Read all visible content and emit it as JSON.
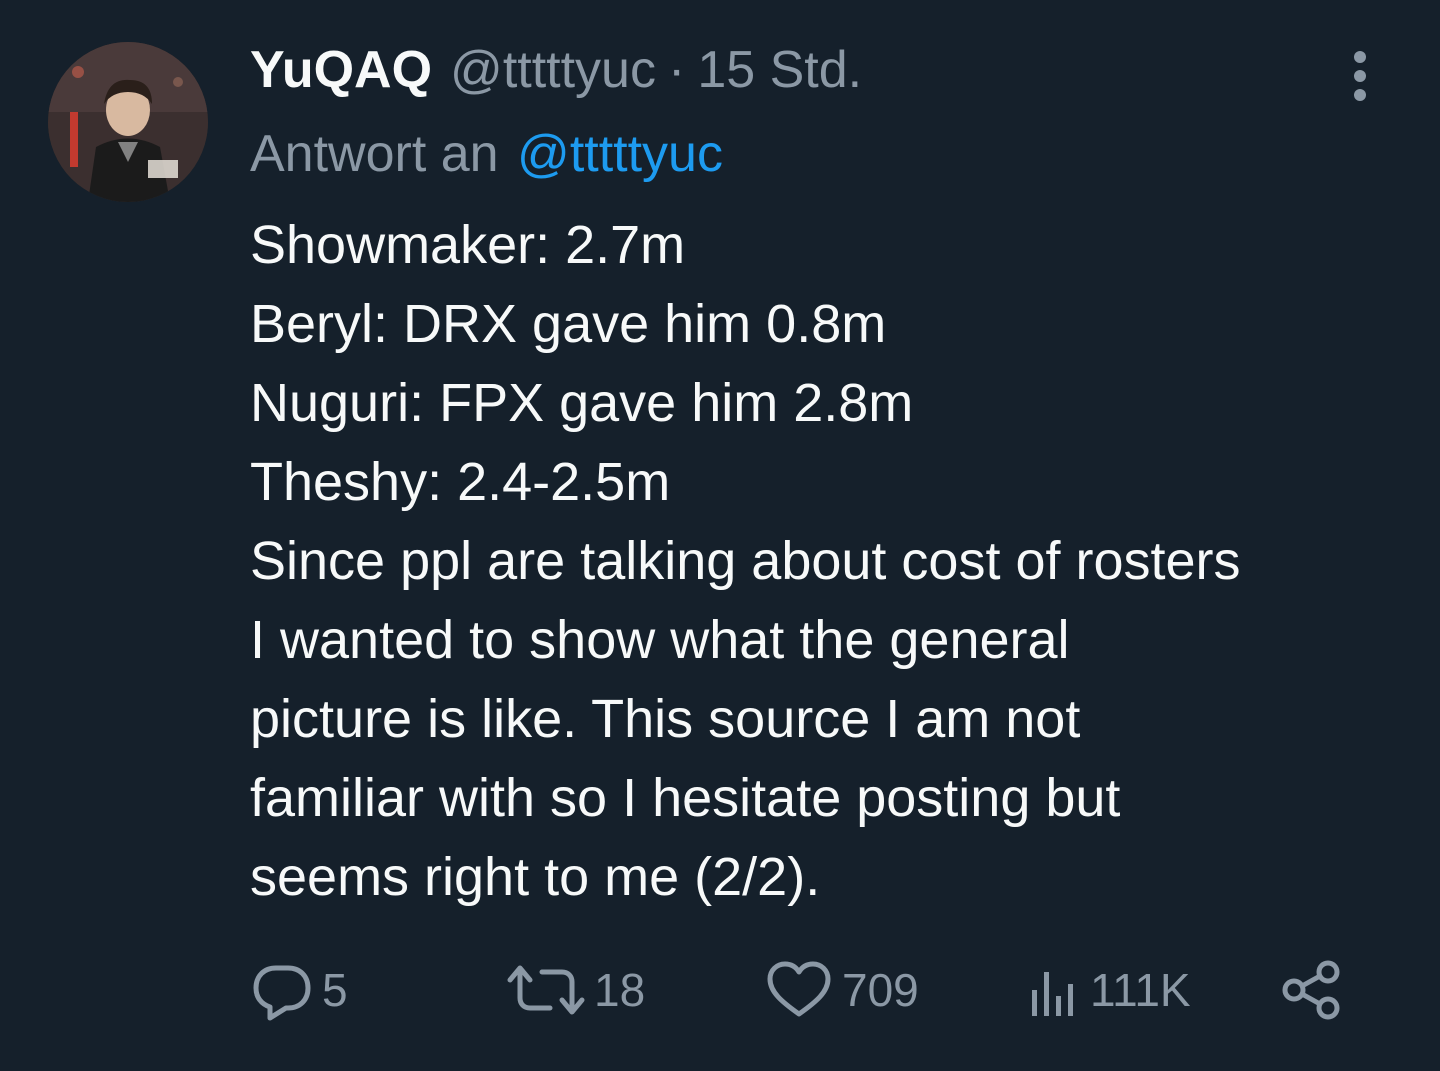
{
  "tweet": {
    "display_name": "YuQAQ",
    "handle": "@tttttyuc",
    "separator": "·",
    "timestamp": "15 Std.",
    "reply_prefix": "Antwort an",
    "reply_to": "@tttttyuc",
    "body_lines": [
      "Showmaker: 2.7m",
      "Beryl: DRX gave him 0.8m",
      "Nuguri: FPX gave him 2.8m",
      "Theshy: 2.4-2.5m",
      "Since ppl are talking about cost of rosters",
      "I  wanted to show what the general",
      "picture is like. This source I am not",
      "familiar with so I hesitate posting but",
      "seems right to me (2/2)."
    ]
  },
  "actions": {
    "reply_count": "5",
    "retweet_count": "18",
    "like_count": "709",
    "views_count": "111K"
  },
  "icons": {
    "more": "more-vertical-icon",
    "reply": "reply-bubble-icon",
    "retweet": "retweet-icon",
    "like": "heart-icon",
    "views": "analytics-bars-icon",
    "share": "share-icon"
  },
  "colors": {
    "background": "#15202b",
    "text_primary": "#f7f9f9",
    "text_secondary": "#8b98a5",
    "link": "#1d9bf0"
  }
}
